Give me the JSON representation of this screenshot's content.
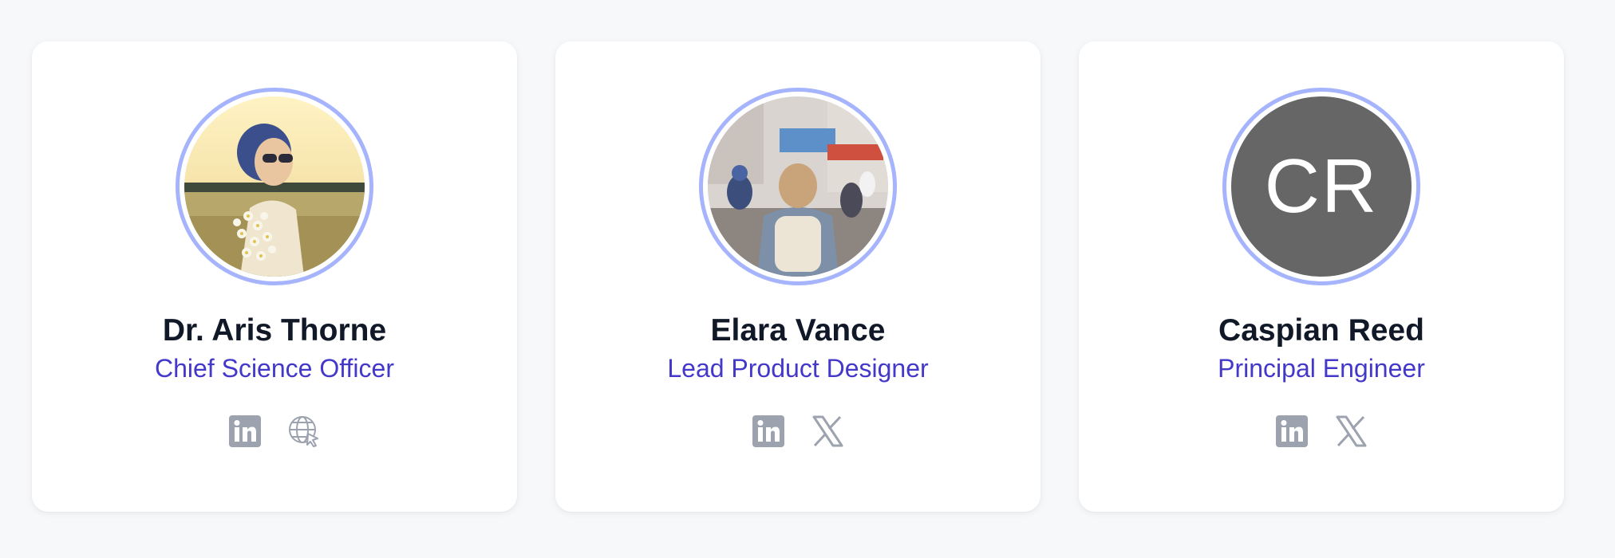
{
  "team": [
    {
      "name": "Dr. Aris Thorne",
      "title": "Chief Science Officer",
      "avatar": {
        "type": "photo",
        "description": "woman-with-sunglasses-and-flowers"
      },
      "socials": [
        "linkedin-icon",
        "website-globe-icon"
      ]
    },
    {
      "name": "Elara Vance",
      "title": "Lead Product Designer",
      "avatar": {
        "type": "photo",
        "description": "person-with-backpack-on-street"
      },
      "socials": [
        "linkedin-icon",
        "x-icon"
      ]
    },
    {
      "name": "Caspian Reed",
      "title": "Principal Engineer",
      "avatar": {
        "type": "initials",
        "initials": "CR"
      },
      "socials": [
        "linkedin-icon",
        "x-icon"
      ]
    }
  ],
  "colors": {
    "page_background": "#f7f8fa",
    "card_background": "#ffffff",
    "avatar_ring": "#a5b4fc",
    "name": "#111827",
    "title": "#4338ca",
    "social_icon": "#9ca3af",
    "initials_background": "#666666"
  }
}
